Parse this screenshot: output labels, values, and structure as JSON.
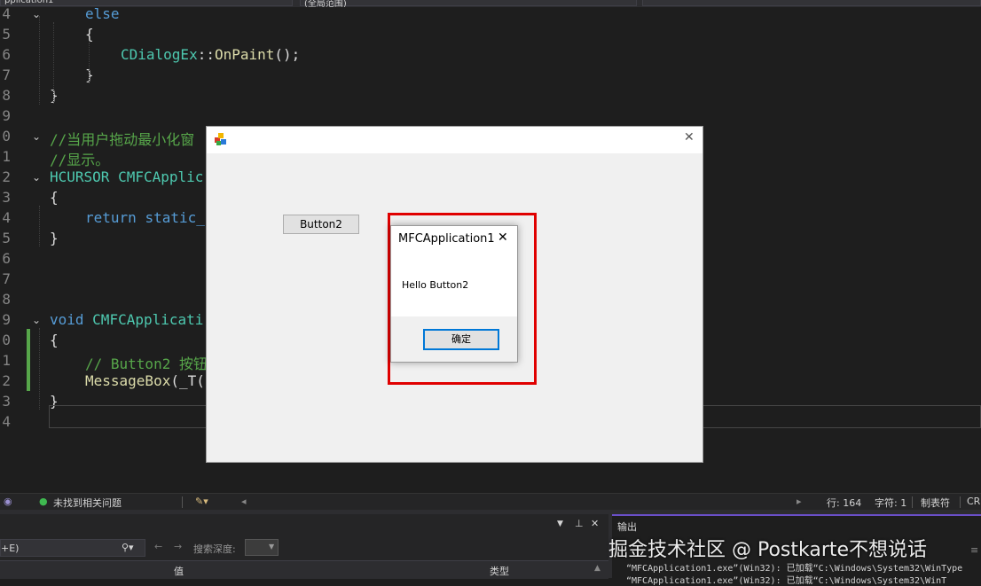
{
  "top_toolbar": {
    "project_combo": "pplication1",
    "scope_combo": "(全局范围)"
  },
  "editor": {
    "lines": [
      {
        "num": "4",
        "parts": [
          [
            "kw",
            "else"
          ]
        ]
      },
      {
        "num": "5",
        "parts": [
          [
            "pl",
            "{"
          ]
        ]
      },
      {
        "num": "6",
        "parts": [
          [
            "ty",
            "CDialogEx"
          ],
          [
            "pl",
            "::"
          ],
          [
            "fn",
            "OnPaint"
          ],
          [
            "pl",
            "();"
          ]
        ]
      },
      {
        "num": "7",
        "parts": [
          [
            "pl",
            "}"
          ]
        ]
      },
      {
        "num": "8",
        "parts": [
          [
            "pl",
            "}"
          ]
        ]
      },
      {
        "num": "9",
        "parts": []
      },
      {
        "num": "0",
        "parts": [
          [
            "cm",
            "//当用户拖动最小化窗"
          ]
        ]
      },
      {
        "num": "1",
        "parts": [
          [
            "cm",
            "//显示。"
          ]
        ]
      },
      {
        "num": "2",
        "parts": [
          [
            "ty",
            "HCURSOR"
          ],
          [
            "pl",
            " "
          ],
          [
            "ty",
            "CMFCApplic"
          ]
        ]
      },
      {
        "num": "3",
        "parts": [
          [
            "pl",
            "{"
          ]
        ]
      },
      {
        "num": "4",
        "parts": [
          [
            "kw",
            "return"
          ],
          [
            "pl",
            " "
          ],
          [
            "kw",
            "static_"
          ]
        ]
      },
      {
        "num": "5",
        "parts": [
          [
            "pl",
            "}"
          ]
        ]
      },
      {
        "num": "6",
        "parts": []
      },
      {
        "num": "7",
        "parts": []
      },
      {
        "num": "8",
        "parts": []
      },
      {
        "num": "9",
        "parts": [
          [
            "kw",
            "void"
          ],
          [
            "pl",
            " "
          ],
          [
            "ty",
            "CMFCApplicati"
          ]
        ]
      },
      {
        "num": "0",
        "parts": [
          [
            "pl",
            "{"
          ]
        ]
      },
      {
        "num": "1",
        "parts": [
          [
            "cm",
            "// Button2 按钮"
          ]
        ]
      },
      {
        "num": "2",
        "parts": [
          [
            "fn",
            "MessageBox"
          ],
          [
            "pl",
            "(_T("
          ]
        ]
      },
      {
        "num": "3",
        "parts": [
          [
            "pl",
            "}"
          ]
        ]
      },
      {
        "num": "4",
        "parts": []
      }
    ]
  },
  "dialog": {
    "button2_label": "Button2",
    "close_glyph": "✕"
  },
  "message_box": {
    "title": "MFCApplication1",
    "close_glyph": "✕",
    "message": "Hello Button2",
    "ok_label": "确定"
  },
  "status_bar": {
    "issues": "未找到相关问题",
    "line": "行: 164",
    "char": "字符: 1",
    "tabs": "制表符",
    "eol": "CR"
  },
  "autos_panel": {
    "search_value": "+E)",
    "search_depth_label": "搜索深度:",
    "col_value": "值",
    "col_type": "类型"
  },
  "output_panel": {
    "title": "输出",
    "line1": "“MFCApplication1.exe”(Win32): 已加载“C:\\Windows\\System32\\WinType",
    "line2": "“MFCApplication1.exe”(Win32): 已加载“C:\\Windows\\System32\\WinT"
  },
  "watermark": "掘金技术社区 @ Postkarte不想说话"
}
